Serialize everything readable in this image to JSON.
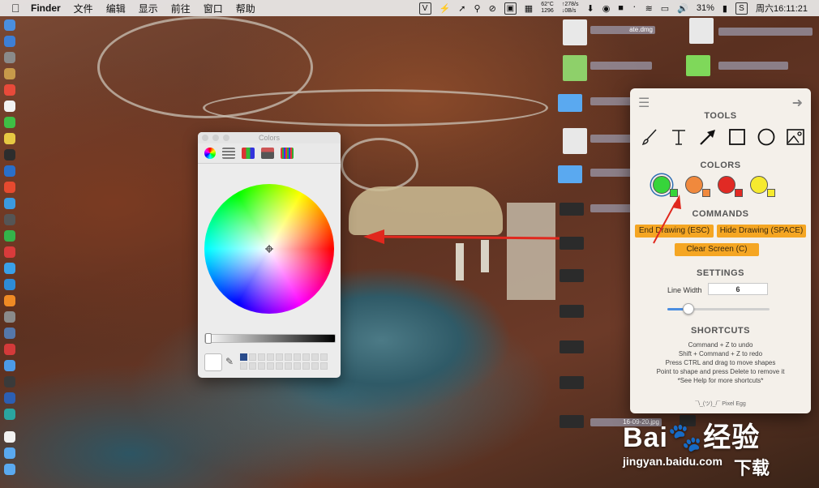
{
  "menubar": {
    "app_name": "Finder",
    "menus": [
      "文件",
      "编辑",
      "显示",
      "前往",
      "窗口",
      "帮助"
    ],
    "temp_line1": "62°C",
    "temp_line2": "1296",
    "net_up": "↑278/s",
    "net_down": "↓0B/s",
    "battery": "31%",
    "clock": "周六16:11:21"
  },
  "desktop_files": {
    "labels": [
      "ate.dmg",
      "16-09-20.jpg"
    ]
  },
  "colors_window": {
    "title": "Colors"
  },
  "drawing_panel": {
    "headers": {
      "tools": "TOOLS",
      "colors": "COLORS",
      "commands": "COMMANDS",
      "settings": "SETTINGS",
      "shortcuts": "SHORTCUTS"
    },
    "tools": [
      "brush-icon",
      "text-icon",
      "arrow-icon",
      "rectangle-icon",
      "circle-icon",
      "image-icon"
    ],
    "colors": [
      {
        "name": "green",
        "hex": "#36d53a",
        "selected": true
      },
      {
        "name": "orange",
        "hex": "#f0893d",
        "selected": false
      },
      {
        "name": "red",
        "hex": "#e12a24",
        "selected": false
      },
      {
        "name": "yellow",
        "hex": "#f6ea2e",
        "selected": false
      }
    ],
    "commands": {
      "end_drawing": "End Drawing (ESC)",
      "hide_drawing": "Hide Drawing (SPACE)",
      "clear_screen": "Clear Screen (C)"
    },
    "settings": {
      "line_width_label": "Line Width",
      "line_width_value": "6",
      "line_width_slider_fraction": 0.2
    },
    "shortcuts": [
      "Command + Z to undo",
      "Shift + Command + Z to redo",
      "Press CTRL and drag to move shapes",
      "Point to shape and press Delete to remove it",
      "*See Help for more shortcuts*"
    ],
    "credit": "¯\\_(ツ)_/¯ Pixel Egg"
  },
  "watermark": {
    "brand": "Bai",
    "brand_cn": "经验",
    "url": "jingyan.baidu.com",
    "badge": "下载"
  },
  "accent_colors": {
    "command_button": "#f5a623",
    "annotation_arrow": "#e0281e"
  }
}
